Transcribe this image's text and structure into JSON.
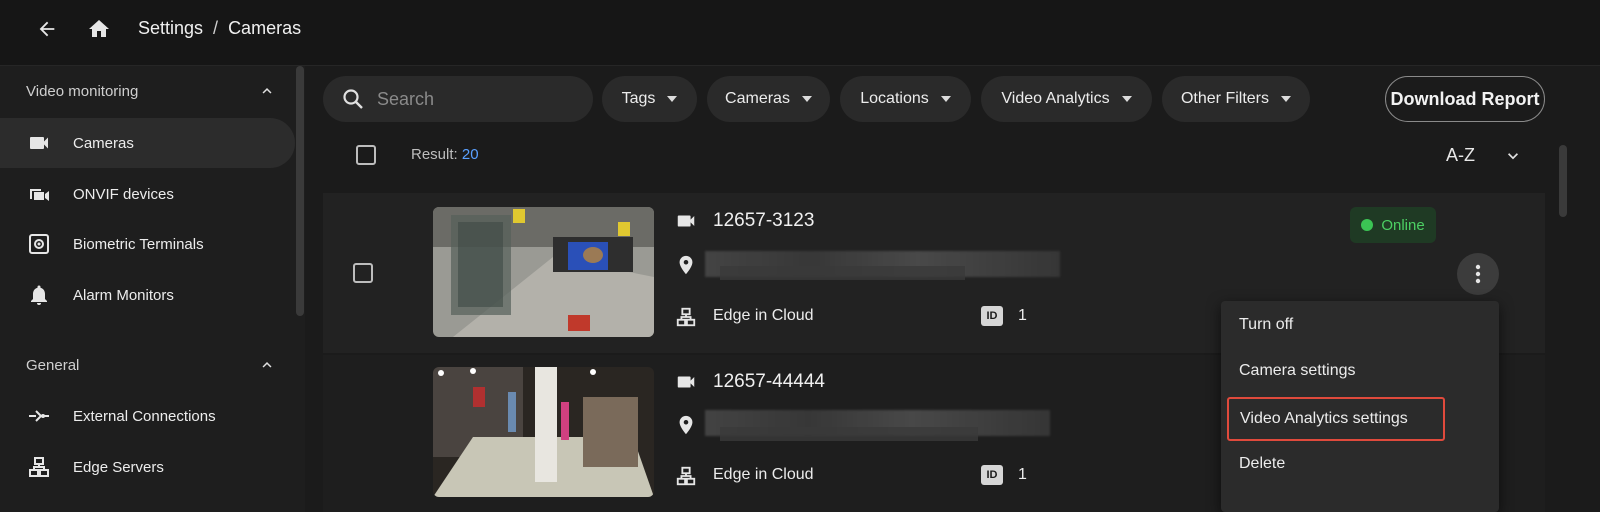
{
  "breadcrumb": {
    "section": "Settings",
    "separator": "/",
    "page": "Cameras"
  },
  "sidebar": {
    "sections": [
      {
        "title": "Video monitoring"
      },
      {
        "title": "General"
      }
    ],
    "items": [
      {
        "label": "Cameras",
        "icon": "video-camera-icon",
        "active": true
      },
      {
        "label": "ONVIF devices",
        "icon": "onvif-devices-icon"
      },
      {
        "label": "Biometric Terminals",
        "icon": "biometric-terminal-icon"
      },
      {
        "label": "Alarm Monitors",
        "icon": "bell-icon"
      },
      {
        "label": "External Connections",
        "icon": "connection-icon"
      },
      {
        "label": "Edge Servers",
        "icon": "server-icon"
      }
    ]
  },
  "toolbar": {
    "search_placeholder": "Search",
    "filters": [
      "Tags",
      "Cameras",
      "Locations",
      "Video Analytics",
      "Other Filters"
    ],
    "download_label": "Download Report"
  },
  "results": {
    "label": "Result:",
    "count": "20",
    "sort": "A-Z"
  },
  "cameras": [
    {
      "name": "12657-3123",
      "server": "Edge in Cloud",
      "id": "1",
      "status": "Online"
    },
    {
      "name": "12657-44444",
      "server": "Edge in Cloud",
      "id": "1"
    }
  ],
  "id_badge_label": "ID",
  "context_menu": {
    "items": [
      "Turn off",
      "Camera settings",
      "Video Analytics settings",
      "Delete"
    ],
    "highlighted": "Video Analytics settings"
  },
  "colors": {
    "accent": "#5aa0ff",
    "online": "#3bc454",
    "highlight": "#e04a3c"
  }
}
